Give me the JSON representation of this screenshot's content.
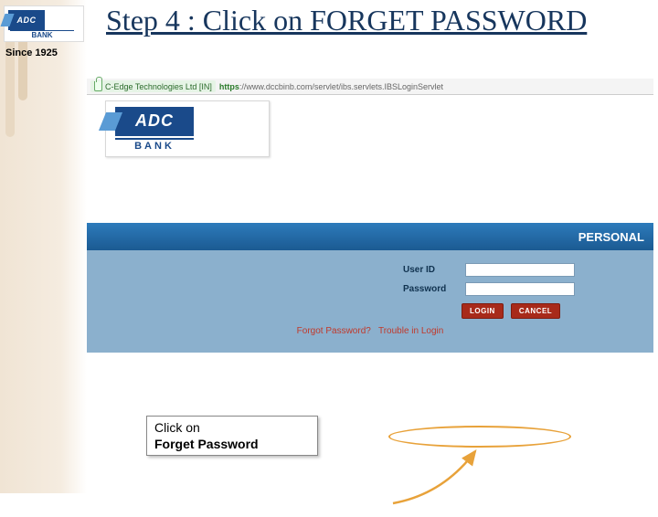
{
  "sidebar": {
    "logo_text": "ADC",
    "logo_sub": "BANK",
    "since_label": "Since 1925"
  },
  "title": "Step 4 : Click on FORGET PASSWORD",
  "browser": {
    "cert_label": "C-Edge Technologies Ltd [IN]",
    "url_scheme": "https",
    "url_rest": "://www.dccbinb.com/servlet/ibs.servlets.IBSLoginServlet"
  },
  "site_logo": {
    "text": "ADC",
    "sub": "BANK"
  },
  "login_band": {
    "header": "PERSONAL",
    "user_label": "User ID",
    "user_value": "",
    "pass_label": "Password",
    "pass_value": "",
    "login_btn": "LOGIN",
    "cancel_btn": "CANCEL",
    "forgot_link": "Forgot Password?",
    "trouble_link": "Trouble in Login"
  },
  "callout": {
    "line1": "Click on",
    "line2": "Forget Password"
  }
}
